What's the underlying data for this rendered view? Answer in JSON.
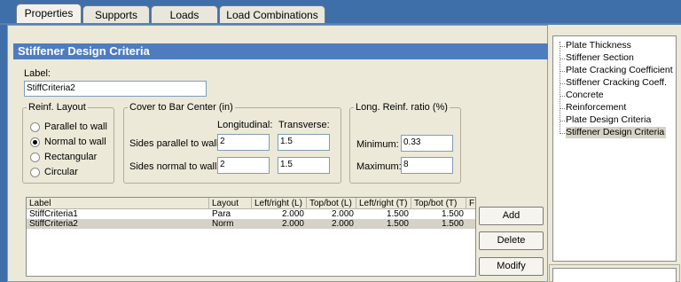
{
  "tabs": [
    "Properties",
    "Supports",
    "Loads",
    "Load Combinations"
  ],
  "header": {
    "title": "Stiffener Design Criteria"
  },
  "label_field": {
    "caption": "Label:",
    "value": "StiffCriteria2"
  },
  "reinf_layout": {
    "legend": "Reinf. Layout",
    "options": [
      "Parallel to wall",
      "Normal to wall",
      "Rectangular",
      "Circular"
    ],
    "selected": "Normal to wall"
  },
  "cover": {
    "legend": "Cover to Bar Center (in)",
    "col_long": "Longitudinal:",
    "col_trans": "Transverse:",
    "row_parallel": "Sides parallel to wall:",
    "row_normal": "Sides normal to wall:",
    "parallel_long": "2",
    "parallel_trans": "1.5",
    "normal_long": "2",
    "normal_trans": "1.5"
  },
  "ratio": {
    "legend": "Long. Reinf. ratio (%)",
    "min_label": "Minimum:",
    "min_value": "0.33",
    "max_label": "Maximum:",
    "max_value": "8"
  },
  "table": {
    "columns": [
      "Label",
      "Layout",
      "Left/right (L)",
      "Top/bot (L)",
      "Left/right (T)",
      "Top/bot (T)",
      "F"
    ],
    "rows": [
      [
        "StiffCriteria1",
        "Para",
        "2.000",
        "2.000",
        "1.500",
        "1.500"
      ],
      [
        "StiffCriteria2",
        "Norm",
        "2.000",
        "2.000",
        "1.500",
        "1.500"
      ]
    ]
  },
  "buttons": {
    "add": "Add",
    "delete": "Delete",
    "modify": "Modify"
  },
  "tree": {
    "items": [
      "Plate Thickness",
      "Stiffener Section",
      "Plate Cracking Coefficient",
      "Stiffener Cracking Coeff.",
      "Concrete",
      "Reinforcement",
      "Plate Design Criteria",
      "Stiffener Design Criteria"
    ],
    "selected_index": 7
  },
  "colors": {
    "header_bar": "#4e7cbf",
    "background": "#3f6fa9",
    "panel": "#ece9d8"
  }
}
